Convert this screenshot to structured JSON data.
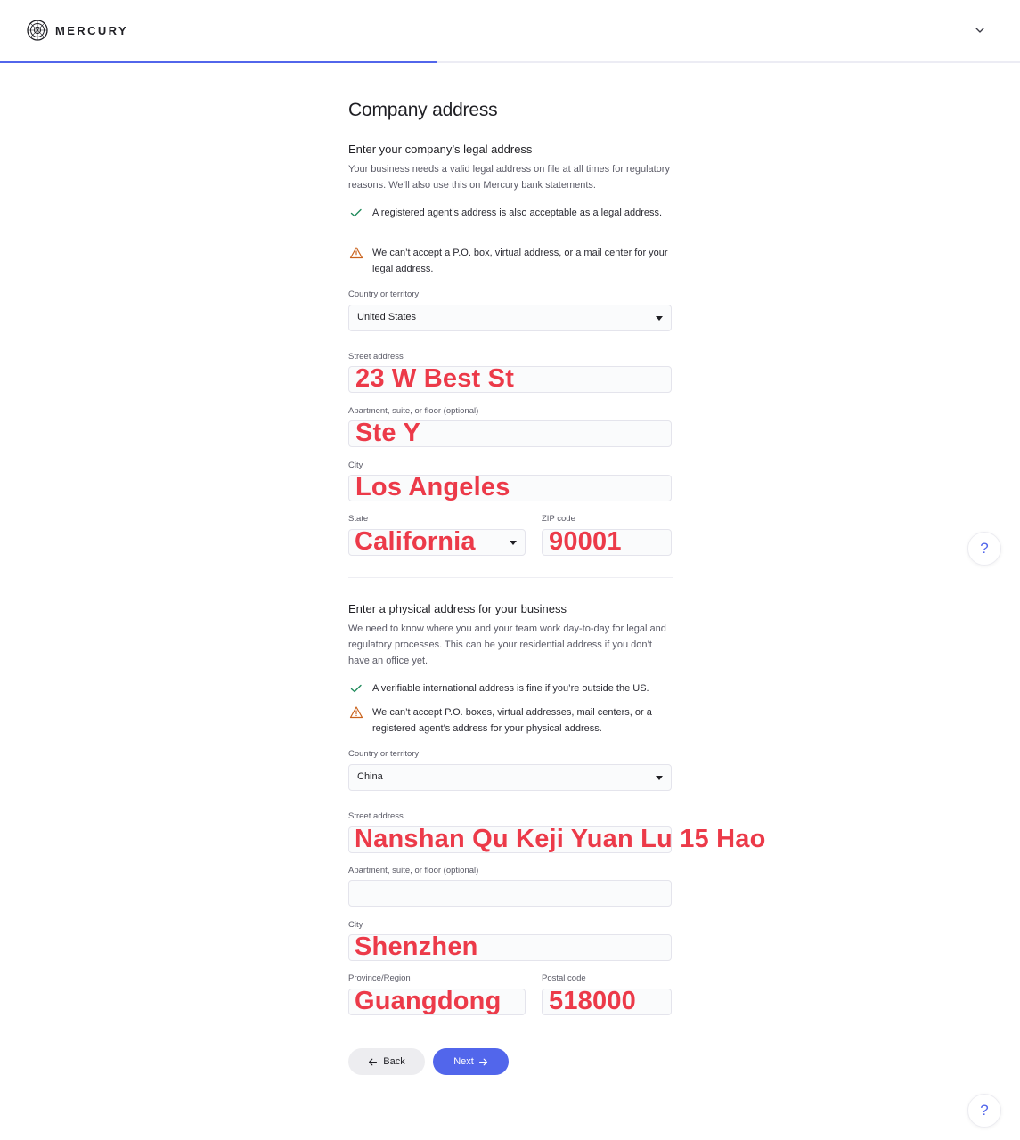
{
  "header": {
    "brand": "MERCURY",
    "progress_fraction": 0.428
  },
  "page_title": "Company address",
  "legal": {
    "title": "Enter your company’s legal address",
    "description": "Your business needs a valid legal address on file at all times for regulatory reasons. We’ll also use this on Mercury bank statements.",
    "note_ok": "A registered agent’s address is also acceptable as a legal address.",
    "note_warn": "We can’t accept a P.O. box, virtual address, or a mail center for your legal address.",
    "country_label": "Country or territory",
    "country_value": "United States",
    "street_label": "Street address",
    "street_value": "23 W Best St",
    "apt_label": "Apartment, suite, or floor (optional)",
    "apt_value": "Ste Y",
    "city_label": "City",
    "city_value": "Los Angeles",
    "state_label": "State",
    "state_value": "California",
    "zip_label": "ZIP code",
    "zip_value": "90001"
  },
  "physical": {
    "title": "Enter a physical address for your business",
    "description": "We need to know where you and your team work day-to-day for legal and regulatory processes. This can be your residential address if you don’t have an office yet.",
    "note_ok": "A verifiable international address is fine if you’re outside the US.",
    "note_warn": "We can’t accept P.O. boxes, virtual addresses, mail centers, or a registered agent’s address for your physical address.",
    "country_label": "Country or territory",
    "country_value": "China",
    "street_label": "Street address",
    "street_value": "Nanshan Qu Keji Yuan Lu 15 Hao",
    "apt_label": "Apartment, suite, or floor (optional)",
    "apt_value": "",
    "city_label": "City",
    "city_value": "Shenzhen",
    "province_label": "Province/Region",
    "province_value": "Guangdong",
    "postal_label": "Postal code",
    "postal_value": "518000"
  },
  "actions": {
    "back_label": "Back",
    "next_label": "Next"
  },
  "help_label": "?",
  "colors": {
    "accent": "#5266eb",
    "annotation": "#ec3a49",
    "ok": "#1f8a5b",
    "warn": "#c9621c"
  }
}
